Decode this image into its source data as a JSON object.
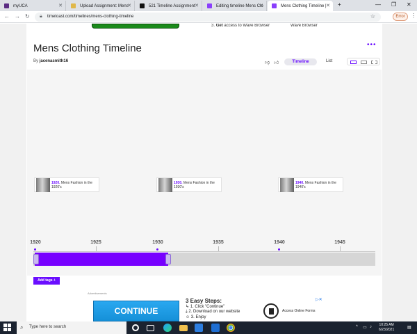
{
  "browser": {
    "tabs": [
      {
        "title": "myUCA",
        "color": "#5b2c83"
      },
      {
        "title": "Upload Assignment: Mens",
        "color": "#e0b84a"
      },
      {
        "title": "521 Timeline Assignment",
        "color": "#111111"
      },
      {
        "title": "Editing timeline Mens Clo",
        "color": "#8a3ffc"
      },
      {
        "title": "Mens Clothing Timeline |",
        "color": "#8a3ffc"
      }
    ],
    "new_tab": "+",
    "url": "timetoast.com/timelines/mens-clothing-timeline",
    "error_button": "Error"
  },
  "topad": {
    "step_num": "3.",
    "step_bold": "Get",
    "step_rest": "access to Wave Browser",
    "right": "Wave Browser"
  },
  "timeline": {
    "title": "Mens Clothing Timeline",
    "by_prefix": "By",
    "author": "jacenasmith16",
    "views": {
      "timeline": "Timeline",
      "list": "List"
    },
    "events": [
      {
        "year": "1920.",
        "text": "Mens Fashion in the 1920's"
      },
      {
        "year": "1930.",
        "text": "Mens Fashion in the 1930's"
      },
      {
        "year": "1940.",
        "text": "Mens Fashion in the 1940's"
      }
    ],
    "axis_ticks": [
      "1920",
      "1925",
      "1930",
      "1935",
      "1940",
      "1945"
    ],
    "add_tags": "Add tags +",
    "accent": "#6a0dff"
  },
  "ad": {
    "label": "Advertisements",
    "cta": "CONTINUE",
    "heading": "3 Easy Steps:",
    "steps": [
      "1. Click \"Continue\"",
      "2. Download on our website",
      "3. Enjoy"
    ],
    "form_label": "Access Online Forms"
  },
  "taskbar": {
    "search_placeholder": "Type here to search",
    "time": "10:25 AM",
    "date": "6/23/2021"
  }
}
